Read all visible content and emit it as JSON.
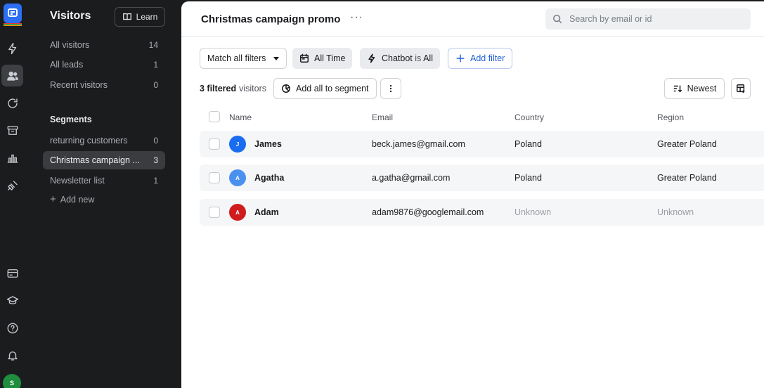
{
  "sidebar": {
    "title": "Visitors",
    "learn_label": "Learn",
    "items": [
      {
        "label": "All visitors",
        "count": "14"
      },
      {
        "label": "All leads",
        "count": "1"
      },
      {
        "label": "Recent visitors",
        "count": "0"
      }
    ],
    "segments_title": "Segments",
    "segments": [
      {
        "label": "returning customers",
        "count": "0"
      },
      {
        "label": "Christmas campaign ...",
        "count": "3"
      },
      {
        "label": "Newsletter list",
        "count": "1"
      }
    ],
    "add_new_label": "Add new"
  },
  "rail": {
    "avatar_initial": "S",
    "icons": [
      "lightning-icon",
      "users-icon",
      "chat-icon",
      "archive-icon",
      "reports-icon",
      "plug-icon",
      "billing-icon",
      "academy-icon",
      "help-icon",
      "bell-icon"
    ]
  },
  "header": {
    "title": "Christmas campaign promo",
    "more": "···",
    "search_placeholder": "Search by email or id"
  },
  "filters": {
    "match": "Match all filters",
    "time": "All Time",
    "chatbot_prefix": "Chatbot",
    "chatbot_mid": "is",
    "chatbot_value": "All",
    "add_filter": "Add filter"
  },
  "toolbar": {
    "filtered_count": "3 filtered",
    "filtered_label": "visitors",
    "add_to_segment": "Add all to segment",
    "sort": "Newest"
  },
  "table": {
    "columns": [
      "Name",
      "Email",
      "Country",
      "Region"
    ],
    "rows": [
      {
        "initial": "J",
        "color": "#1a6cf0",
        "name": "James",
        "email": "beck.james@gmail.com",
        "country": "Poland",
        "region": "Greater Poland",
        "known": true
      },
      {
        "initial": "A",
        "color": "#4a90ee",
        "name": "Agatha",
        "email": "a.gatha@gmail.com",
        "country": "Poland",
        "region": "Greater Poland",
        "known": true
      },
      {
        "initial": "A",
        "color": "#d01c1c",
        "name": "Adam",
        "email": "adam9876@googlemail.com",
        "country": "Unknown",
        "region": "Unknown",
        "known": false
      }
    ]
  },
  "colors": {
    "accent": "#2160d8",
    "sidebar_bg": "#1b1c1e",
    "active_item": "#3a3c40"
  }
}
